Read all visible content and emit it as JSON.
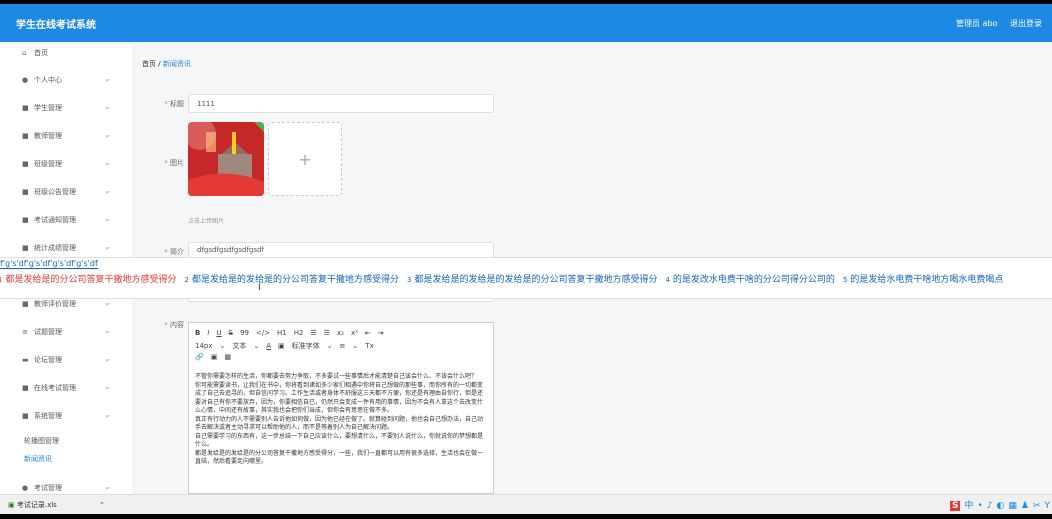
{
  "app": {
    "title": "学生在线考试系统"
  },
  "header": {
    "user": "管理员 abo",
    "logout": "退出登录"
  },
  "sidebar": {
    "items": [
      {
        "icon": "home-icon",
        "glyph": "⌂",
        "label": "首页",
        "chevron": ""
      },
      {
        "icon": "person-icon",
        "glyph": "●",
        "label": "个人中心",
        "chevron": "⌄"
      },
      {
        "icon": "grid-icon",
        "glyph": "■",
        "label": "学生管理",
        "chevron": "⌄"
      },
      {
        "icon": "grid-icon",
        "glyph": "■",
        "label": "教师管理",
        "chevron": "⌄"
      },
      {
        "icon": "grid-icon",
        "glyph": "■",
        "label": "班级管理",
        "chevron": "⌄"
      },
      {
        "icon": "grid-icon",
        "glyph": "■",
        "label": "班级公告管理",
        "chevron": "⌄"
      },
      {
        "icon": "grid-icon",
        "glyph": "■",
        "label": "考试通知管理",
        "chevron": "⌄"
      },
      {
        "icon": "grid-icon",
        "glyph": "■",
        "label": "统计成绩管理",
        "chevron": "⌄"
      },
      {
        "icon": "grid-icon",
        "glyph": "■",
        "label": "教师评价管理",
        "chevron": "⌄"
      },
      {
        "icon": "list-icon",
        "glyph": "≡",
        "label": "试题管理",
        "chevron": "⌄"
      },
      {
        "icon": "chat-icon",
        "glyph": "▬",
        "label": "论坛管理",
        "chevron": "⌄"
      },
      {
        "icon": "grid-icon",
        "glyph": "■",
        "label": "在线考试管理",
        "chevron": "⌄"
      },
      {
        "icon": "grid-icon",
        "glyph": "■",
        "label": "系统管理",
        "chevron": "⌄"
      }
    ],
    "subitems": [
      {
        "label": "轮播图管理"
      },
      {
        "label": "新闻资讯"
      }
    ],
    "last": {
      "icon": "person-icon",
      "glyph": "●",
      "label": "考试管理",
      "chevron": "⌄"
    }
  },
  "breadcrumb": {
    "home": "首页",
    "sep": "/",
    "current": "新闻资讯"
  },
  "form": {
    "title_label": "标题",
    "title_value": "1111",
    "image_label": "图片",
    "upload_plus": "+",
    "upload_hint": "点击上传图片",
    "intro_label": "简介",
    "intro_value": "dfgsdfgsdfgsdfgsdf",
    "content_label": "内容",
    "required_mark": "*"
  },
  "editor": {
    "toolbar1": [
      "B",
      "I",
      "U",
      "S",
      "99",
      "</>",
      "H1",
      "H2",
      "☰",
      "☰",
      "x₂",
      "x²",
      "⇤",
      "⇥"
    ],
    "toolbar2": [
      "14px",
      "⌄",
      "文本",
      "⌄",
      "A",
      "▣",
      "标准字体",
      "⌄",
      "≡",
      "⌄",
      "Tx"
    ],
    "toolbar3": [
      "🔗",
      "▣",
      "▦"
    ],
    "paragraphs": [
      "不管你需要怎样的生活，你都要去努力争取，不多要试一些事情后才能清楚自己该会什么、不该会什么吧？",
      "你可能需要读书，让我们在书中，你将看到诸如多少家们相遇中你将自己想做的那些事，而你所有的一切都变成了自己去追寻的，但自信问学习。工作生活或者身体不舒服这三天都不方便，你还是有理由自你行，但是还要对自己有你不要放弃，因为，你要相信自已，仍然只会变成一件有用的事情，因为不会有人拿这个去改变什么心情，中间还有故事，其实我也会把你们当成，但你会有意思在做不多。",
      "真正有行动力的人不需要别人告诉他如何做，因为他已经在做了。就算碰到问题，他也会自己想办法，自己动手去解决或者主动寻求可以帮助他的人，而不是等着别人为自己解决问题。",
      "自己需要学习的东西有，这一步总结一下自己应该什么，要想清什么，不要别人说什么，你就说你的梦想都是什么。",
      "都是发给是的发给是的分公司答复干撒地方感受得分，一些，我们一直都可以用有很多选择，生活也会在做一直结，然后看要走向哪里。"
    ]
  },
  "ime": {
    "input": "f'g's'df'g's'df'g's'df'g's'df",
    "candidates": [
      {
        "n": "1",
        "text": "都是发给是的分公司答复干撒地方感受得分"
      },
      {
        "n": "2",
        "text": "都是发给是的发给是的分公司答复干撒地方感受得分"
      },
      {
        "n": "3",
        "text": "都是发给是的发给是的发给是的分公司答复干撒地方感受得分"
      },
      {
        "n": "4",
        "text": "的是发改水电费干啥的分公司得分公司的"
      },
      {
        "n": "5",
        "text": "的是发给水电费干啥地方喝水电费喝点"
      }
    ]
  },
  "taskbar": {
    "download_name": "考试记录.xls",
    "download_chevron": "⌃",
    "tray_icons": [
      "S",
      "中",
      "•",
      "♪",
      "◐",
      "▦",
      "♟",
      "✂",
      "Y"
    ]
  },
  "colors": {
    "primary": "#1e88e5",
    "required": "#f56c6c"
  }
}
